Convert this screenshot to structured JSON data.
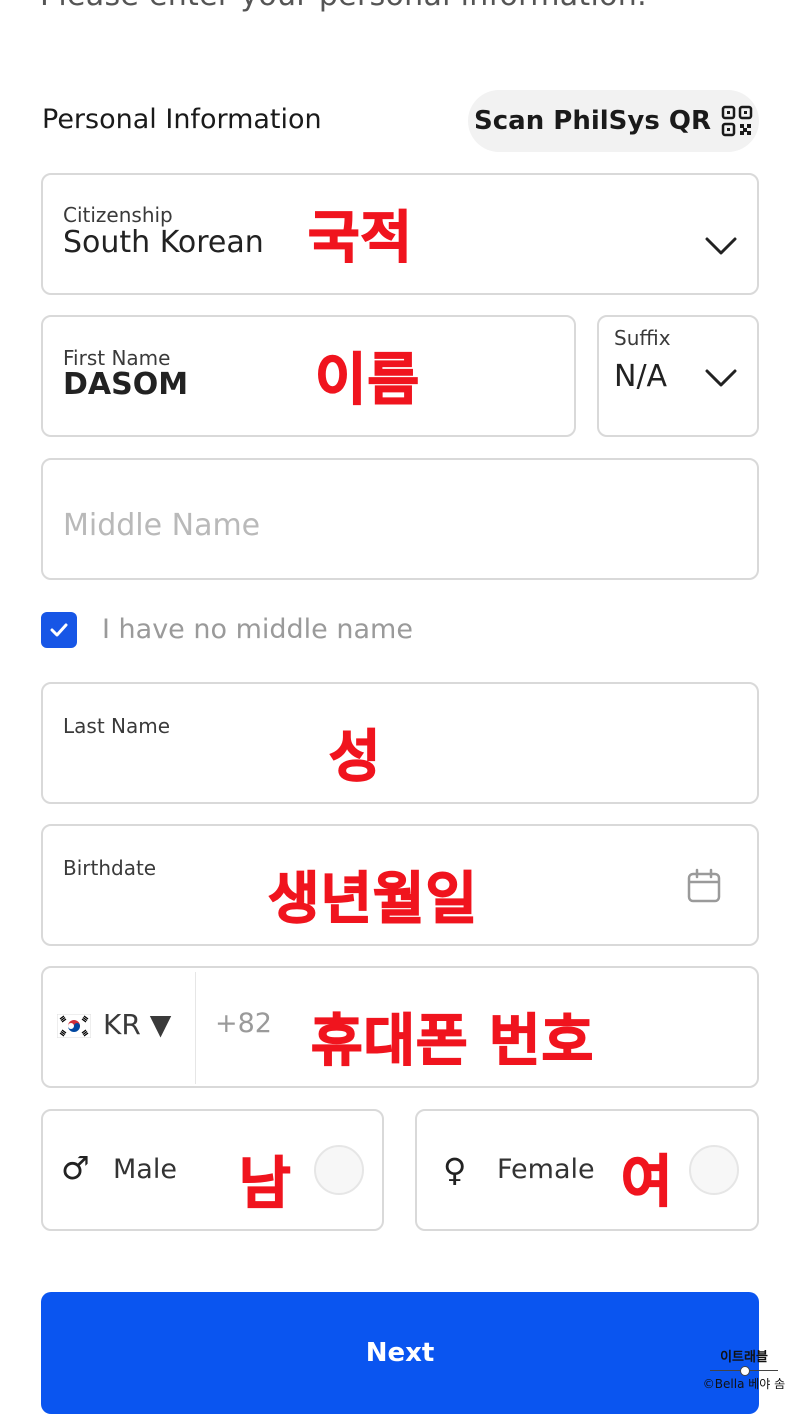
{
  "header": {
    "instruction": "Please enter your personal information.",
    "section_title": "Personal Information",
    "scan_button_label": "Scan PhilSys QR",
    "scan_icon": "qr-code-icon"
  },
  "form": {
    "citizenship": {
      "label": "Citizenship",
      "value": "South Korean",
      "annotation": "국적"
    },
    "first_name": {
      "label": "First Name",
      "value": "DASOM",
      "annotation": "이름"
    },
    "suffix": {
      "label": "Suffix",
      "value": "N/A"
    },
    "middle_name": {
      "placeholder": "Middle Name"
    },
    "no_middle_name": {
      "label": "I have no middle name",
      "checked": true
    },
    "last_name": {
      "label": "Last Name",
      "value": "",
      "annotation": "성"
    },
    "birthdate": {
      "label": "Birthdate",
      "value": "",
      "annotation": "생년월일",
      "icon": "calendar-icon"
    },
    "phone": {
      "country_code": "KR ▼",
      "dial_code": "+82",
      "annotation": "휴대폰 번호",
      "flag": "south-korea-flag-icon"
    },
    "gender": {
      "male": {
        "label": "Male",
        "symbol": "♂",
        "annotation": "남"
      },
      "female": {
        "label": "Female",
        "symbol": "♀",
        "annotation": "여"
      }
    }
  },
  "actions": {
    "next_label": "Next"
  },
  "watermark": {
    "line1": "이트래블",
    "line2": "©Bella 베야 솜"
  },
  "colors": {
    "primary": "#0a55f0",
    "annotation": "#f0141e",
    "border": "#d9d9d9"
  }
}
